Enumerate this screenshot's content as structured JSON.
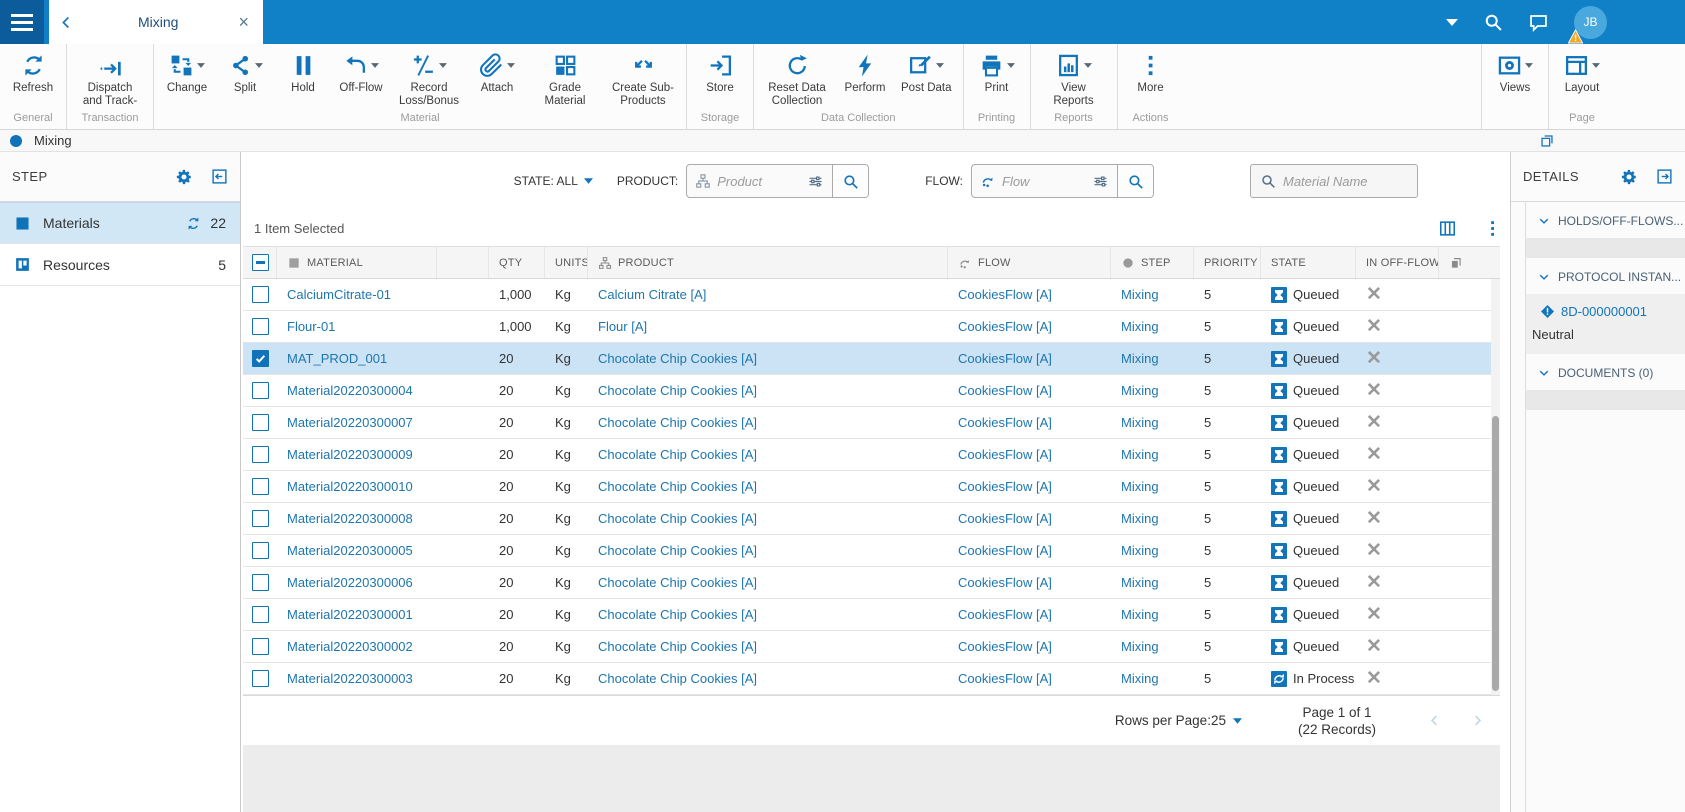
{
  "topbar": {
    "tab_title": "Mixing",
    "user_initials": "JB"
  },
  "toolbar": {
    "groups": [
      {
        "label": "General",
        "buttons": [
          {
            "label": "Refresh",
            "icon": "refresh",
            "dropdown": false
          }
        ]
      },
      {
        "label": "Transaction",
        "buttons": [
          {
            "label": "Dispatch and Track-",
            "icon": "dispatch",
            "dropdown": false
          }
        ]
      },
      {
        "label": "Material",
        "buttons": [
          {
            "label": "Change",
            "icon": "change",
            "dropdown": true
          },
          {
            "label": "Split",
            "icon": "split",
            "dropdown": true
          },
          {
            "label": "Hold",
            "icon": "hold",
            "dropdown": false
          },
          {
            "label": "Off-Flow",
            "icon": "offflow",
            "dropdown": true
          },
          {
            "label": "Record Loss/Bonus",
            "icon": "lossbonus",
            "dropdown": true
          },
          {
            "label": "Attach",
            "icon": "attach",
            "dropdown": true
          },
          {
            "label": "Grade Material",
            "icon": "grade",
            "dropdown": false
          },
          {
            "label": "Create Sub-Products",
            "icon": "subproducts",
            "dropdown": false
          }
        ]
      },
      {
        "label": "Storage",
        "buttons": [
          {
            "label": "Store",
            "icon": "store",
            "dropdown": false
          }
        ]
      },
      {
        "label": "Data Collection",
        "buttons": [
          {
            "label": "Reset Data Collection",
            "icon": "resetdata",
            "dropdown": false
          },
          {
            "label": "Perform",
            "icon": "perform",
            "dropdown": false
          },
          {
            "label": "Post Data",
            "icon": "postdata",
            "dropdown": true
          }
        ]
      },
      {
        "label": "Printing",
        "buttons": [
          {
            "label": "Print",
            "icon": "print",
            "dropdown": true
          }
        ]
      },
      {
        "label": "Reports",
        "buttons": [
          {
            "label": "View Reports",
            "icon": "reports",
            "dropdown": true
          }
        ]
      },
      {
        "label": "Actions",
        "buttons": [
          {
            "label": "More",
            "icon": "more",
            "dropdown": false
          }
        ]
      }
    ],
    "right_groups": [
      {
        "label": "",
        "buttons": [
          {
            "label": "Views",
            "icon": "views",
            "dropdown": true
          }
        ]
      },
      {
        "label": "Page",
        "buttons": [
          {
            "label": "Layout",
            "icon": "layout",
            "dropdown": true
          }
        ]
      }
    ]
  },
  "breadcrumb": {
    "title": "Mixing"
  },
  "left_panel": {
    "title": "STEP",
    "items": [
      {
        "label": "Materials",
        "count": "22",
        "selected": true,
        "refresh": true,
        "icon": "materials"
      },
      {
        "label": "Resources",
        "count": "5",
        "selected": false,
        "refresh": false,
        "icon": "resources"
      }
    ]
  },
  "filters": {
    "state_label": "STATE: ALL",
    "product_label": "PRODUCT:",
    "product_placeholder": "Product",
    "flow_label": "FLOW:",
    "flow_placeholder": "Flow",
    "material_placeholder": "Material Name"
  },
  "table": {
    "selection_text": "1 Item Selected",
    "columns": {
      "material": "MATERIAL",
      "qty": "QTY",
      "units": "UNITS",
      "product": "PRODUCT",
      "flow": "FLOW",
      "step": "STEP",
      "priority": "PRIORITY",
      "state": "STATE",
      "in_off_flow": "IN OFF-FLOW"
    },
    "rows": [
      {
        "material": "CalciumCitrate-01",
        "qty": "1,000",
        "units": "Kg",
        "product": "Calcium Citrate [A]",
        "flow": "CookiesFlow [A]",
        "step": "Mixing",
        "priority": "5",
        "state": "Queued",
        "state_kind": "queued",
        "checked": false,
        "selected": false
      },
      {
        "material": "Flour-01",
        "qty": "1,000",
        "units": "Kg",
        "product": "Flour [A]",
        "flow": "CookiesFlow [A]",
        "step": "Mixing",
        "priority": "5",
        "state": "Queued",
        "state_kind": "queued",
        "checked": false,
        "selected": false
      },
      {
        "material": "MAT_PROD_001",
        "qty": "20",
        "units": "Kg",
        "product": "Chocolate Chip Cookies [A]",
        "flow": "CookiesFlow [A]",
        "step": "Mixing",
        "priority": "5",
        "state": "Queued",
        "state_kind": "queued",
        "checked": true,
        "selected": true
      },
      {
        "material": "Material20220300004",
        "qty": "20",
        "units": "Kg",
        "product": "Chocolate Chip Cookies [A]",
        "flow": "CookiesFlow [A]",
        "step": "Mixing",
        "priority": "5",
        "state": "Queued",
        "state_kind": "queued",
        "checked": false,
        "selected": false
      },
      {
        "material": "Material20220300007",
        "qty": "20",
        "units": "Kg",
        "product": "Chocolate Chip Cookies [A]",
        "flow": "CookiesFlow [A]",
        "step": "Mixing",
        "priority": "5",
        "state": "Queued",
        "state_kind": "queued",
        "checked": false,
        "selected": false
      },
      {
        "material": "Material20220300009",
        "qty": "20",
        "units": "Kg",
        "product": "Chocolate Chip Cookies [A]",
        "flow": "CookiesFlow [A]",
        "step": "Mixing",
        "priority": "5",
        "state": "Queued",
        "state_kind": "queued",
        "checked": false,
        "selected": false
      },
      {
        "material": "Material20220300010",
        "qty": "20",
        "units": "Kg",
        "product": "Chocolate Chip Cookies [A]",
        "flow": "CookiesFlow [A]",
        "step": "Mixing",
        "priority": "5",
        "state": "Queued",
        "state_kind": "queued",
        "checked": false,
        "selected": false
      },
      {
        "material": "Material20220300008",
        "qty": "20",
        "units": "Kg",
        "product": "Chocolate Chip Cookies [A]",
        "flow": "CookiesFlow [A]",
        "step": "Mixing",
        "priority": "5",
        "state": "Queued",
        "state_kind": "queued",
        "checked": false,
        "selected": false
      },
      {
        "material": "Material20220300005",
        "qty": "20",
        "units": "Kg",
        "product": "Chocolate Chip Cookies [A]",
        "flow": "CookiesFlow [A]",
        "step": "Mixing",
        "priority": "5",
        "state": "Queued",
        "state_kind": "queued",
        "checked": false,
        "selected": false
      },
      {
        "material": "Material20220300006",
        "qty": "20",
        "units": "Kg",
        "product": "Chocolate Chip Cookies [A]",
        "flow": "CookiesFlow [A]",
        "step": "Mixing",
        "priority": "5",
        "state": "Queued",
        "state_kind": "queued",
        "checked": false,
        "selected": false
      },
      {
        "material": "Material20220300001",
        "qty": "20",
        "units": "Kg",
        "product": "Chocolate Chip Cookies [A]",
        "flow": "CookiesFlow [A]",
        "step": "Mixing",
        "priority": "5",
        "state": "Queued",
        "state_kind": "queued",
        "checked": false,
        "selected": false
      },
      {
        "material": "Material20220300002",
        "qty": "20",
        "units": "Kg",
        "product": "Chocolate Chip Cookies [A]",
        "flow": "CookiesFlow [A]",
        "step": "Mixing",
        "priority": "5",
        "state": "Queued",
        "state_kind": "queued",
        "checked": false,
        "selected": false
      },
      {
        "material": "Material20220300003",
        "qty": "20",
        "units": "Kg",
        "product": "Chocolate Chip Cookies [A]",
        "flow": "CookiesFlow [A]",
        "step": "Mixing",
        "priority": "5",
        "state": "In Process",
        "state_kind": "inprocess",
        "checked": false,
        "selected": false
      }
    ],
    "pagination": {
      "rows_per_page_label": "Rows per Page:25",
      "page_label": "Page 1 of 1",
      "records_label": "(22 Records)"
    }
  },
  "right_panel": {
    "title": "DETAILS",
    "sections": {
      "holds": "HOLDS/OFF-FLOWS...",
      "protocol": "PROTOCOL INSTAN...",
      "documents": "DOCUMENTS (0)"
    },
    "protocol": {
      "id": "8D-000000001",
      "status": "Neutral"
    }
  },
  "colors": {
    "accent": "#1275BC",
    "topbar": "#1181C7",
    "hamburger": "#0C5C9C",
    "selected_row": "#CBE3F5",
    "badge": "#1275BC",
    "warning": "#F5A623"
  },
  "icons": {
    "state_queued": "hourglass-badge",
    "state_inprocess": "sync-badge",
    "protocol": "diamond-exclamation",
    "off_flow_remove": "x-mark"
  }
}
